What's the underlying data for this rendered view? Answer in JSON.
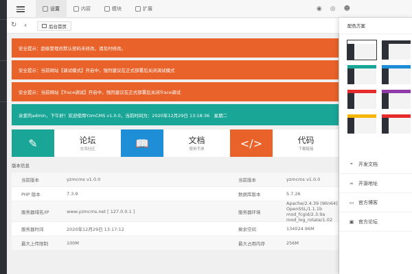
{
  "topnav": {
    "items": [
      {
        "label": "设置",
        "icon": "gear-icon",
        "active": true
      },
      {
        "label": "内容",
        "icon": "document-icon",
        "active": false
      },
      {
        "label": "模块",
        "icon": "cube-icon",
        "active": false
      },
      {
        "label": "扩展",
        "icon": "puzzle-icon",
        "active": false
      }
    ],
    "right_icons": [
      "theme-icon",
      "fullscreen-icon",
      "user-icon"
    ]
  },
  "tabbar": {
    "home_tab": "后台首页"
  },
  "alerts": [
    "安全提示：超级管理员默认密码未修改，请及时修改。",
    "安全提示：当前网站【调试模式】开启中，强烈建议在正式部署后关闭调试模式",
    "安全提示：当前网站【Trace调试】开启中，强烈建议在正式部署后关闭Trace调试"
  ],
  "welcome": "亲爱的admin，下午好！欢迎使用YzmCMS v1.0.0，当前时间为：2020年12月29日 13:18:36　星期二",
  "tiles": [
    {
      "title": "论坛",
      "subtitle": "交流社区",
      "color": "#1aa696",
      "icon": "edit-icon",
      "glyph": "✎"
    },
    {
      "title": "文档",
      "subtitle": "使用手册",
      "color": "#1e8fd6",
      "icon": "book-icon",
      "glyph": "📖"
    },
    {
      "title": "代码",
      "subtitle": "下载链接",
      "color": "#e8622a",
      "icon": "code-icon",
      "glyph": "</>"
    }
  ],
  "section_title": "版本信息",
  "info": [
    {
      "k1": "当前版本",
      "v1": "yzmcms v1.0.0",
      "k2": "当前版本",
      "v2": "yzmcms v1.0.0"
    },
    {
      "k1": "PHP 版本",
      "v1": "7.3.9",
      "k2": "数据库版本",
      "v2": "5.7.26"
    },
    {
      "k1": "服务器域名/IP",
      "v1": "www.yzmcms.net [ 127.0.0.1 ]",
      "k2": "服务器环境",
      "v2": "Apache/2.4.39 (Win64) OpenSSL/1.1.1b mod_fcgid/2.3.9a mod_log_rotate/1.02"
    },
    {
      "k1": "服务器时间",
      "v1": "2020年12月29日 13:17:12",
      "k2": "剩余空间",
      "v2": "134024.96M"
    },
    {
      "k1": "最大上传限制",
      "v1": "100M",
      "k2": "最大占用内存",
      "v2": "256M"
    }
  ],
  "panel": {
    "title": "配色方案",
    "themes": [
      {
        "side": "#2d3036",
        "head": "#ffffff",
        "selected": true
      },
      {
        "side": "#2d3036",
        "head": "#2d3036",
        "selected": false
      },
      {
        "side": "#2d3036",
        "head": "#1aa696",
        "selected": false
      },
      {
        "side": "#2d3036",
        "head": "#1e8fd6",
        "selected": false
      },
      {
        "side": "#2d3036",
        "head": "#e52b2b",
        "selected": false
      },
      {
        "side": "#2d3036",
        "head": "#8e3aa8",
        "selected": false
      },
      {
        "side": "#2d3036",
        "head": "#f5b500",
        "selected": false
      },
      {
        "side": "#2d3036",
        "head": "#e52b2b",
        "selected": false
      }
    ],
    "links": [
      {
        "label": "开发文档",
        "icon": "paperclip-icon",
        "glyph": "⌖"
      },
      {
        "label": "开源地址",
        "icon": "link-icon",
        "glyph": "∞"
      },
      {
        "label": "官方博客",
        "icon": "message-icon",
        "glyph": "▭"
      },
      {
        "label": "官方论坛",
        "icon": "forum-icon",
        "glyph": "▣"
      }
    ]
  }
}
